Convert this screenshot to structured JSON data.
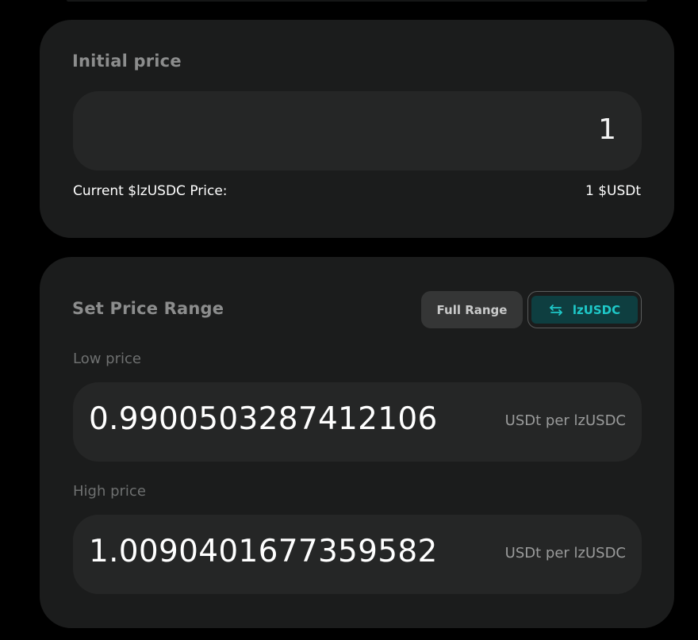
{
  "initial_price": {
    "title": "Initial price",
    "value": "1",
    "current_label": "Current $lzUSDC Price:",
    "current_value": "1 $USDt"
  },
  "price_range": {
    "title": "Set Price Range",
    "full_range_label": "Full Range",
    "token_toggle_label": "lzUSDC",
    "token_toggle_icon": "swap-arrows-icon",
    "low": {
      "label": "Low price",
      "value": "0.9900503287412106",
      "unit": "USDt per lzUSDC"
    },
    "high": {
      "label": "High price",
      "value": "1.0090401677359582",
      "unit": "USDt per lzUSDC"
    }
  },
  "colors": {
    "background": "#000000",
    "card": "#1b1c1c",
    "field": "#252626",
    "accent": "#1ec8c8",
    "accent_bg": "#0e3e40"
  }
}
